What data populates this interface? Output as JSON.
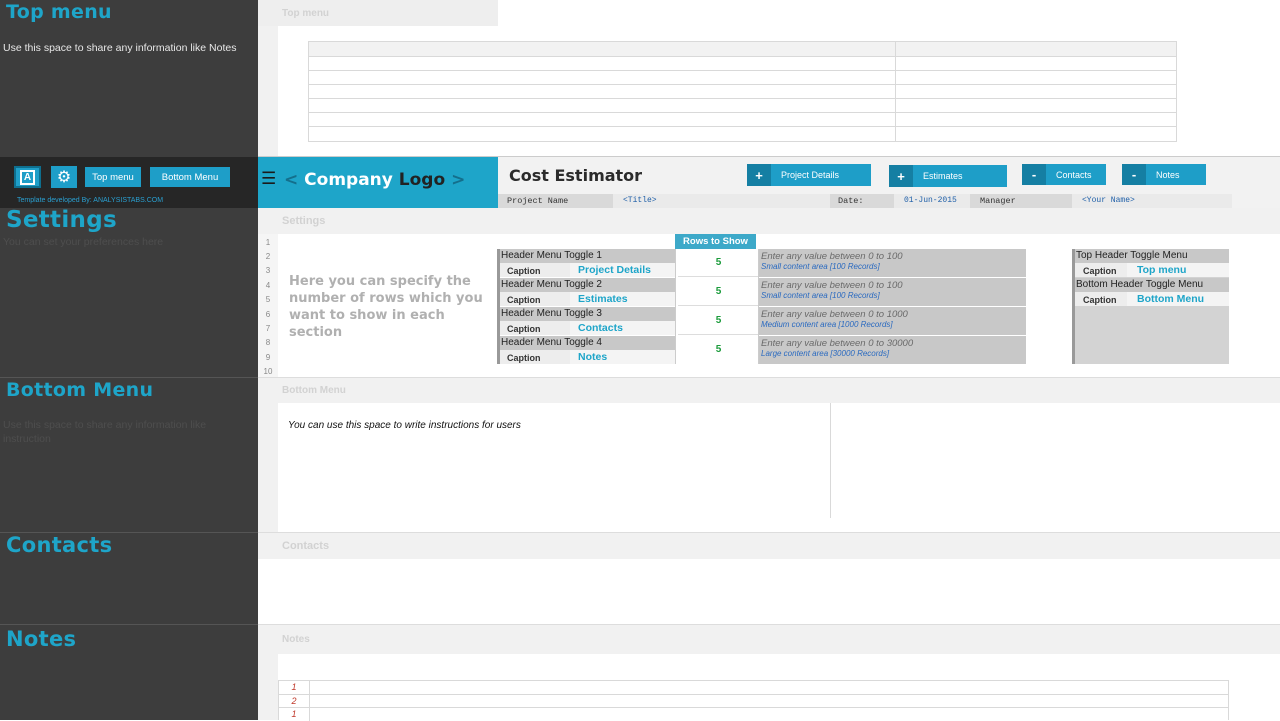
{
  "left_panel": {
    "top_menu": {
      "title": "Top menu",
      "note": "Use this space to share any information like Notes"
    },
    "toolbar": {
      "top_menu_btn": "Top menu",
      "bottom_menu_btn": "Bottom Menu",
      "credit": "Template developed By: ANALYSISTABS.COM"
    },
    "settings": {
      "title": "Settings",
      "note": "You can set your preferences here"
    },
    "bottom_menu": {
      "title": "Bottom Menu",
      "note": "Use this space to share any information like instruction"
    },
    "contacts": {
      "title": "Contacts"
    },
    "notes": {
      "title": "Notes"
    }
  },
  "bands": {
    "top_menu": "Top menu",
    "settings": "Settings",
    "bottom_menu": "Bottom Menu",
    "contacts": "Contacts",
    "notes": "Notes"
  },
  "header": {
    "logo_left": "<",
    "logo_company": "Company",
    "logo_logo": "Logo",
    "logo_right": ">",
    "app_title": "Cost Estimator",
    "buttons": [
      {
        "sign": "+",
        "label": "Project Details"
      },
      {
        "sign": "+",
        "label": "Estimates"
      },
      {
        "sign": "-",
        "label": "Contacts"
      },
      {
        "sign": "-",
        "label": "Notes"
      }
    ],
    "project_name_label": "Project Name",
    "project_name_value": "<Title>",
    "date_label": "Date:",
    "date_value": "01-Jun-2015",
    "manager_label": "Manager",
    "manager_value": "<Your Name>"
  },
  "settings": {
    "row_numbers": [
      "1",
      "2",
      "3",
      "4",
      "5",
      "6",
      "7",
      "8",
      "9",
      "10"
    ],
    "intro": "Here you can specify the number of rows which you want  to show in each section",
    "rows_header": "Rows to Show",
    "toggles": [
      {
        "name": "Header Menu Toggle 1",
        "caption_label": "Caption",
        "caption": "Project Details",
        "rows": "5",
        "hint": "Enter any value between 0 to 100",
        "hint_sub": "Small content area [100 Records]"
      },
      {
        "name": "Header Menu Toggle 2",
        "caption_label": "Caption",
        "caption": "Estimates",
        "rows": "5",
        "hint": "Enter any value between 0 to 100",
        "hint_sub": "Small content area [100 Records]"
      },
      {
        "name": "Header Menu Toggle 3",
        "caption_label": "Caption",
        "caption": "Contacts",
        "rows": "5",
        "hint": "Enter any value between 0 to 1000",
        "hint_sub": "Medium content area [1000 Records]"
      },
      {
        "name": "Header Menu Toggle 4",
        "caption_label": "Caption",
        "caption": "Notes",
        "rows": "5",
        "hint": "Enter any value between 0 to 30000",
        "hint_sub": "Large content area [30000 Records]"
      }
    ],
    "top_toggle": {
      "name": "Top Header Toggle Menu",
      "caption_label": "Caption",
      "caption": "Top menu"
    },
    "bottom_toggle": {
      "name": "Bottom Header Toggle Menu",
      "caption_label": "Caption",
      "caption": "Bottom Menu"
    }
  },
  "bottom_menu": {
    "instructions": "You can use this space to write instructions for users"
  },
  "notes": {
    "row_numbers": [
      "1",
      "2",
      "1"
    ]
  },
  "colors": {
    "accent": "#1ea5c9",
    "dark_panel": "#3d3d3d",
    "green": "#1b9b3b"
  }
}
